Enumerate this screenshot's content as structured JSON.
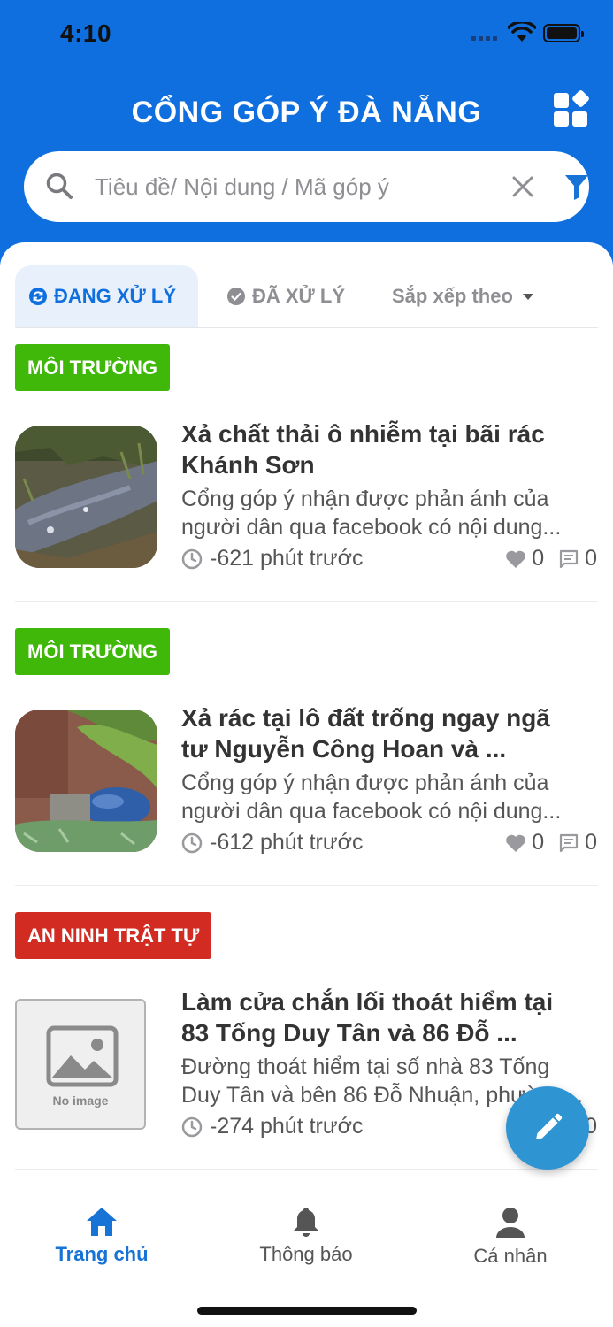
{
  "status_bar": {
    "time": "4:10"
  },
  "header": {
    "title": "CỔNG GÓP Ý ĐÀ NẴNG",
    "menu_icon": "grid-apps-icon"
  },
  "search": {
    "placeholder": "Tiêu đề/ Nội dung / Mã góp ý",
    "value": ""
  },
  "tabs": {
    "processing": "ĐANG XỬ LÝ",
    "processed": "ĐÃ XỬ LÝ",
    "sort_label": "Sắp xếp theo",
    "active": "processing"
  },
  "feed": [
    {
      "tag": "MÔI TRƯỜNG",
      "tag_color": "#3fb80a",
      "title_line1": "Xả chất thải ô nhiễm tại bãi rác",
      "title_line2": "Khánh Sơn",
      "desc_line1": "Cổng góp ý nhận được phản ánh của",
      "desc_line2": "người dân qua facebook có nội dung...",
      "time": "-621 phút trước",
      "likes": "0",
      "comments": "0"
    },
    {
      "tag": "MÔI TRƯỜNG",
      "tag_color": "#3fb80a",
      "title_line1": "Xả rác tại lô đất trống ngay ngã",
      "title_line2": "tư Nguyễn Công Hoan và ...",
      "desc_line1": "Cổng góp ý nhận được phản ánh của",
      "desc_line2": "người dân qua facebook có nội dung...",
      "time": "-612 phút trước",
      "likes": "0",
      "comments": "0"
    },
    {
      "tag": "AN NINH TRẬT TỰ",
      "tag_color": "#d22b22",
      "no_image_label": "No image",
      "title_line1": "Làm cửa chắn lối thoát hiểm tại",
      "title_line2": "83 Tống Duy Tân và 86 Đỗ ...",
      "desc_line1": "Đường thoát hiểm tại số nhà 83 Tống",
      "desc_line2": "Duy Tân và bên 86 Đỗ Nhuận, phường...",
      "time": "-274 phút trước",
      "likes": "0",
      "comments": "0"
    }
  ],
  "bottom_nav": {
    "home": "Trang chủ",
    "notifications": "Thông báo",
    "profile": "Cá nhân",
    "active": "home"
  },
  "colors": {
    "primary": "#0f6fde",
    "fab": "#2f94d2",
    "env_tag": "#3fb80a",
    "security_tag": "#d22b22"
  }
}
